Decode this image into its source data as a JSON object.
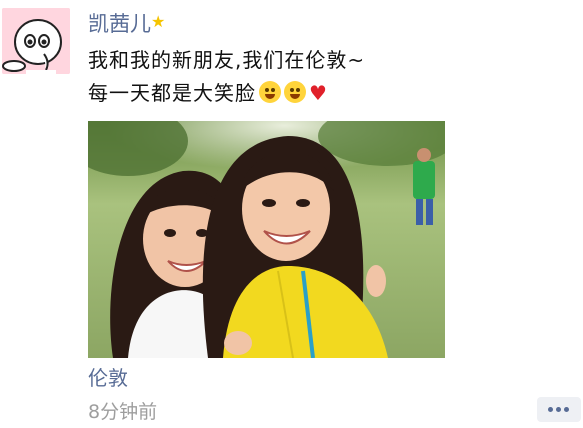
{
  "post": {
    "author": "凯茜儿",
    "text_line1": "我和我的新朋友,我们在伦敦~",
    "text_line2": "每一天都是大笑脸",
    "location": "伦敦",
    "time": "8分钟前"
  },
  "icons": {
    "author_badge": "sparkle-star-icon",
    "emoji": "grinning-face-emoji",
    "heart": "red-heart-emoji",
    "comment": "comment-dots-icon"
  },
  "colors": {
    "link_blue": "#576b95",
    "timestamp_gray": "#9e9e9e",
    "heart_red": "#e0202a",
    "emoji_yellow": "#ffd43b"
  }
}
